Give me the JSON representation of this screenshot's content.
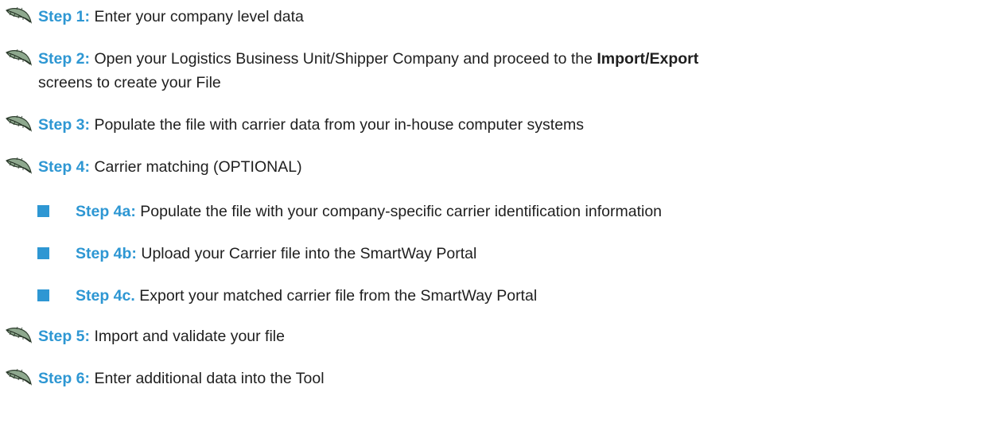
{
  "colors": {
    "accent": "#2e97d3",
    "text": "#1f1f1f",
    "bullet_icon": "leaf-icon"
  },
  "steps": [
    {
      "label": "Step 1:",
      "text": "Enter your company level data"
    },
    {
      "label": "Step 2:",
      "text": "Open your Logistics Business Unit/Shipper Company and proceed to the ",
      "emphasis": "Import/Export",
      "line2": "screens to create your File"
    },
    {
      "label": "Step 3:",
      "text": "Populate the file with carrier data from your in-house computer systems"
    },
    {
      "label": "Step 4:",
      "text": "Carrier matching (OPTIONAL)"
    },
    {
      "label": "Step 4a:",
      "text": "Populate the file with your company-specific carrier identification information"
    },
    {
      "label": "Step 4b:",
      "text": "Upload your Carrier file into the SmartWay Portal"
    },
    {
      "label": "Step 4c.",
      "text": "Export your matched carrier file from the SmartWay Portal"
    },
    {
      "label": "Step 5:",
      "text": "Import and validate your file"
    },
    {
      "label": "Step 6:",
      "text": "Enter additional data into the Tool"
    }
  ]
}
